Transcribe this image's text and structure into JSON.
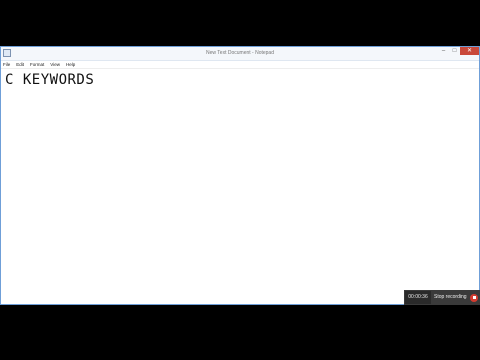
{
  "window": {
    "title": "New Text Document - Notepad",
    "controls": {
      "minimize": "–",
      "maximize": "□",
      "close": "✕"
    }
  },
  "menu": {
    "items": [
      {
        "label": "File"
      },
      {
        "label": "Edit"
      },
      {
        "label": "Format"
      },
      {
        "label": "View"
      },
      {
        "label": "Help"
      }
    ]
  },
  "editor": {
    "content": "C KEYWORDS"
  },
  "recorder": {
    "time": "00:00:36",
    "stop_label": "Stop recording",
    "accent_color": "#d23b2f"
  },
  "icons": {
    "app": "notepad-icon",
    "record": "record-stop-icon"
  }
}
